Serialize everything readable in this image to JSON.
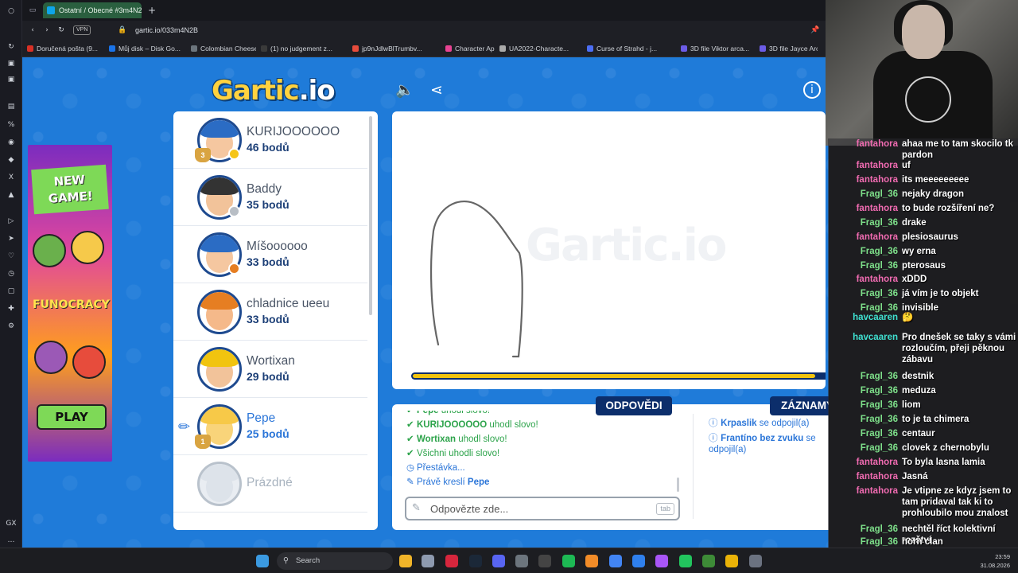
{
  "browser": {
    "tab_title": "Ostatní / Obecné #3m4N2B",
    "url": "gartic.io/033m4N2B",
    "vpn_label": "VPN",
    "bookmarks": [
      "Doručená pošta (9...",
      "Můj disk – Disk Go...",
      "Colombian Cheese...",
      "(1) no judgement z...",
      "jp9nJdlwBlTrumbv...",
      "Character App",
      "UA2022-Characte...",
      "Curse of Strahd - j...",
      "3D file Viktor arca...",
      "3D file Jayce Arca..."
    ]
  },
  "game": {
    "logo_main": "Gartic",
    "logo_suffix": ".io",
    "ad": {
      "new_game": "NEW GAME!",
      "funocracy": "FUNOCRACY",
      "play": "PLAY"
    },
    "players": [
      {
        "name": "KURIJOOOOOO",
        "score": "46 bodů",
        "rank": "3",
        "status_color": "#f5c518"
      },
      {
        "name": "Baddy",
        "score": "35 bodů",
        "status_color": "#b8bec5"
      },
      {
        "name": "Míšoooooo",
        "score": "33 bodů",
        "status_color": "#e67e22"
      },
      {
        "name": "chladnice ueeu",
        "score": "33 bodů"
      },
      {
        "name": "Wortixan",
        "score": "29 bodů"
      },
      {
        "name": "Pepe",
        "score": "25 bodů",
        "rank": "1",
        "drawing": true
      },
      {
        "name": "Prázdné",
        "score": ""
      }
    ],
    "canvas": {
      "watermark": "Gartic.io",
      "timer_fraction": 0.93
    },
    "tabs": {
      "answers": "ODPOVĚDI",
      "log": "ZÁZNAMY"
    },
    "answers": [
      {
        "icon": "check",
        "user": "Pepe",
        "text": " uhodl slovo!"
      },
      {
        "icon": "check",
        "user": "KURIJOOOOOO",
        "text": " uhodl slovo!"
      },
      {
        "icon": "check",
        "user": "Wortixan",
        "text": " uhodl slovo!"
      },
      {
        "icon": "check",
        "user": "",
        "text": "Všichni uhodli slovo!"
      },
      {
        "icon": "clock",
        "user": "",
        "text": "Přestávka..."
      },
      {
        "icon": "pencil",
        "user": "Pepe",
        "text": "Právě kreslí "
      }
    ],
    "answer_input": {
      "placeholder": "Odpovězte zde...",
      "tab_hint": "tab"
    },
    "log": [
      {
        "user": "Krpaslik",
        "text": "se odpojil(a)"
      },
      {
        "user": "Frantíno bez zvuku",
        "text": "se odpojil(a)"
      }
    ]
  },
  "stream_chat": [
    {
      "user": "fantahora",
      "color": "#f06bb1",
      "text": "ahaa me to tam skocilo tk pardon"
    },
    {
      "user": "fantahora",
      "color": "#f06bb1",
      "text": "uf"
    },
    {
      "user": "fantahora",
      "color": "#f06bb1",
      "text": "its meeeeeeeee"
    },
    {
      "user": "Fragl_36",
      "color": "#7ee08a",
      "text": "nejaky dragon"
    },
    {
      "user": "fantahora",
      "color": "#f06bb1",
      "text": "to bude rozšíření ne?"
    },
    {
      "user": "Fragl_36",
      "color": "#7ee08a",
      "text": "drake"
    },
    {
      "user": "fantahora",
      "color": "#f06bb1",
      "text": "plesiosaurus"
    },
    {
      "user": "Fragl_36",
      "color": "#7ee08a",
      "text": "wy erna"
    },
    {
      "user": "Fragl_36",
      "color": "#7ee08a",
      "text": "pterosaus"
    },
    {
      "user": "fantahora",
      "color": "#f06bb1",
      "text": "xDDD"
    },
    {
      "user": "Fragl_36",
      "color": "#7ee08a",
      "text": "já vím je to objekt"
    },
    {
      "user": "Fragl_36",
      "color": "#7ee08a",
      "text": "invisible"
    },
    {
      "user": "havcaaren",
      "color": "#3fe0d0",
      "text": "🤔"
    },
    {
      "user": "havcaaren",
      "color": "#3fe0d0",
      "text": "Pro dnešek se taky s vámi rozloučím, přeji pěknou zábavu"
    },
    {
      "user": "Fragl_36",
      "color": "#7ee08a",
      "text": "destnik"
    },
    {
      "user": "Fragl_36",
      "color": "#7ee08a",
      "text": "meduza"
    },
    {
      "user": "Fragl_36",
      "color": "#7ee08a",
      "text": "liom"
    },
    {
      "user": "Fragl_36",
      "color": "#7ee08a",
      "text": "to je ta chimera"
    },
    {
      "user": "Fragl_36",
      "color": "#7ee08a",
      "text": "centaur"
    },
    {
      "user": "Fragl_36",
      "color": "#7ee08a",
      "text": "clovek z chernobylu"
    },
    {
      "user": "fantahora",
      "color": "#f06bb1",
      "text": "To byla lasna lamia"
    },
    {
      "user": "fantahora",
      "color": "#f06bb1",
      "text": "Jasná"
    },
    {
      "user": "fantahora",
      "color": "#f06bb1",
      "text": "Je vtipne ze kdyz jsem to tam pridaval tak ki to prohloubilo mou znalost"
    },
    {
      "user": "Fragl_36",
      "color": "#7ee08a",
      "text": "nechtěl říct kolektivní rozštví"
    },
    {
      "user": "Fragl_36",
      "color": "#7ee08a",
      "text": "horn clan"
    }
  ],
  "taskbar": {
    "search": "Search",
    "time": "23:59",
    "date": "31.08.2026"
  },
  "colors": {
    "game_bg": "#1f7bd9",
    "accent_dark": "#0c2e6b",
    "guess_green": "#2ca34a",
    "info_blue": "#2a75d8"
  }
}
